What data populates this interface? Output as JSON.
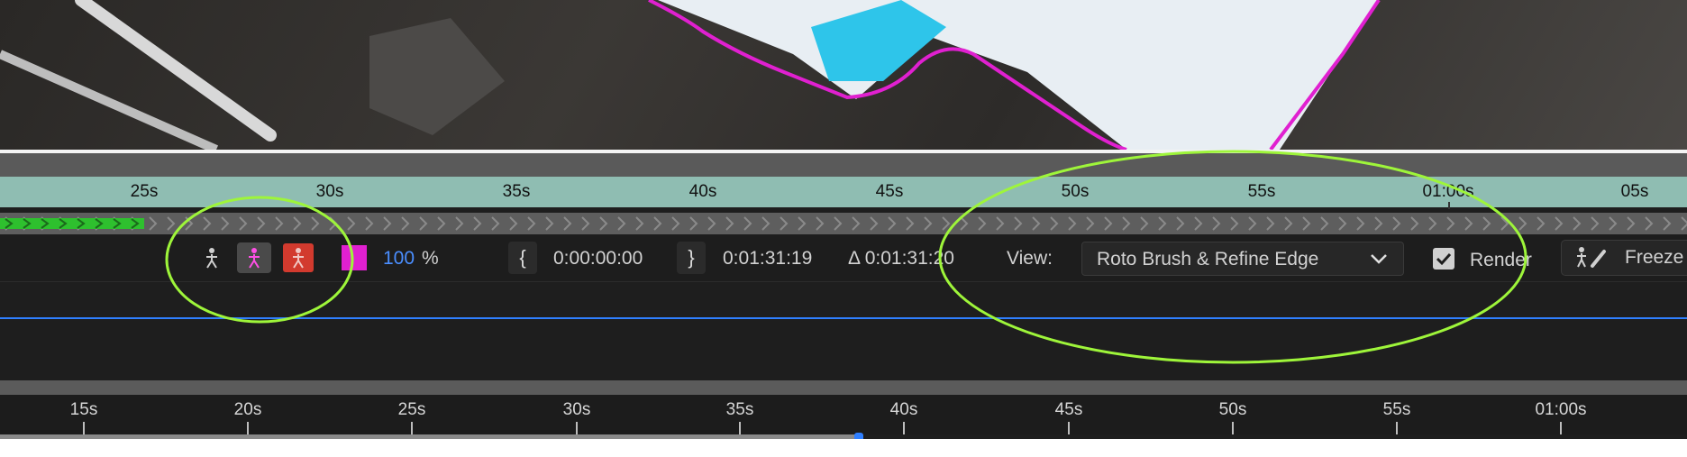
{
  "top_ruler": {
    "labels": [
      "25s",
      "30s",
      "35s",
      "40s",
      "45s",
      "50s",
      "55s",
      "01:00s",
      "05s"
    ]
  },
  "toolbar": {
    "propagation_icons": [
      "propagate-forward-icon",
      "propagate-active-icon",
      "propagate-backward-icon"
    ],
    "matte_color": "#e020d0",
    "opacity_value": "100",
    "opacity_unit": "%",
    "in_point": "0:00:00:00",
    "out_point": "0:01:31:19",
    "duration": "Δ 0:01:31:20",
    "view_label": "View:",
    "view_value": "Roto Brush & Refine Edge",
    "render_label": "Render",
    "freeze_label": "Freeze"
  },
  "bottom_ruler": {
    "labels": [
      "15s",
      "20s",
      "25s",
      "30s",
      "35s",
      "40s",
      "45s",
      "50s",
      "55s",
      "01:00s"
    ]
  },
  "colors": {
    "accent_blue": "#2f7fff",
    "annotation_green": "#9ef53a",
    "progress_green": "#2ec02e",
    "roto_outline": "#e020d0"
  }
}
